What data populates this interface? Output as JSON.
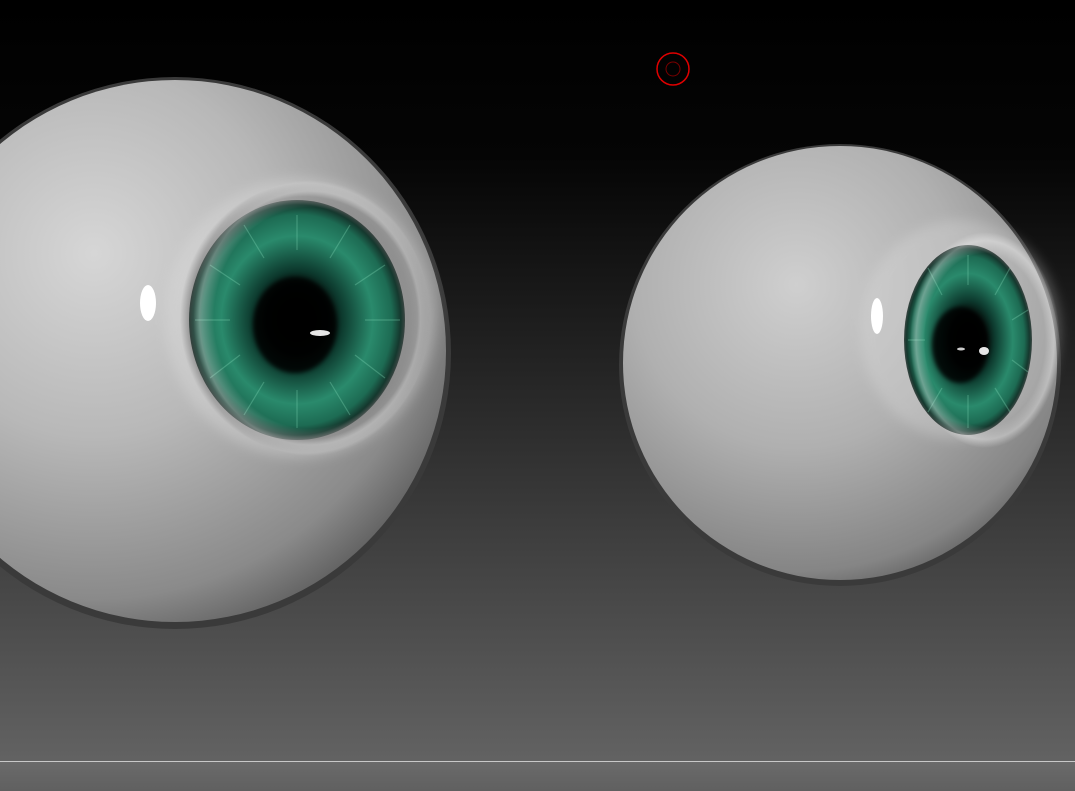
{
  "app": {
    "view": "3d-viewport"
  },
  "scene": {
    "background_top_color": "#000000",
    "background_bottom_color": "#666666",
    "objects": [
      {
        "name": "left-eyeball",
        "iris_color": "#1f6e58"
      },
      {
        "name": "right-eyeball",
        "iris_color": "#1f6e58"
      }
    ]
  },
  "cursor": {
    "shape": "brush-circle-icon",
    "color": "#e00000"
  }
}
